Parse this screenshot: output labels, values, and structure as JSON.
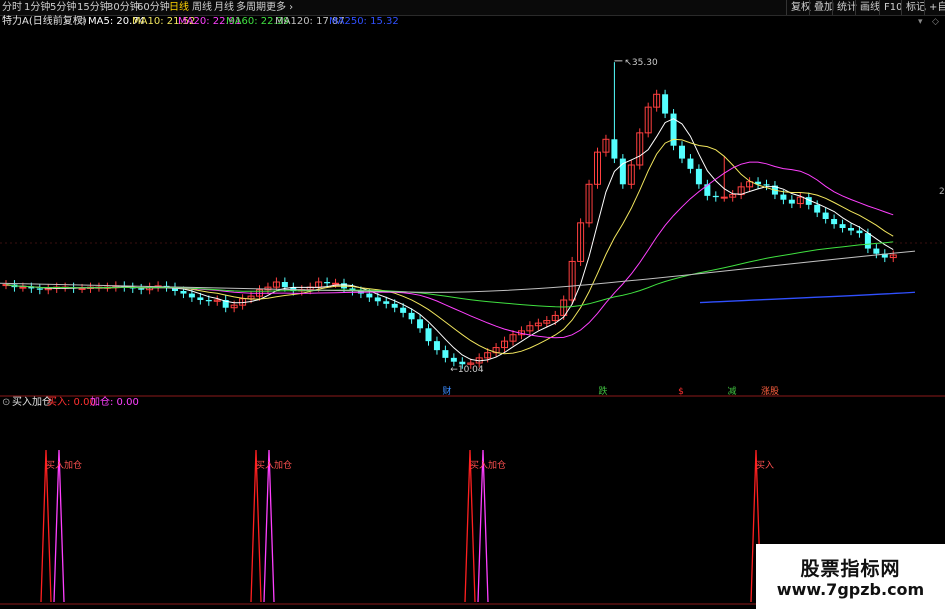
{
  "toolbar": {
    "periods": [
      "分时",
      "1分钟",
      "5分钟",
      "15分钟",
      "30分钟",
      "60分钟",
      "日线",
      "周线",
      "月线",
      "多周期",
      "更多"
    ],
    "active_period": "日线",
    "right_buttons": [
      "复权",
      "叠加",
      "统计",
      "画线",
      "F10",
      "标记",
      "+自"
    ]
  },
  "ma_header": {
    "stock_name": "特力A(日线前复权)",
    "items": [
      {
        "label": "MA5: 20.74",
        "color": "#ffffff"
      },
      {
        "label": "MA10: 21.52",
        "color": "#f2e65e"
      },
      {
        "label": "MA20: 22.91",
        "color": "#ff40ff"
      },
      {
        "label": "MA60: 22.39",
        "color": "#40e040"
      },
      {
        "label": "MA120: 17.87",
        "color": "#c0c0c0"
      },
      {
        "label": "MA250: 15.32",
        "color": "#3050ff"
      }
    ]
  },
  "price_annotations": {
    "high": "35.30",
    "low": "10.04"
  },
  "event_markers": [
    {
      "text": "财",
      "color": "#3a8bff"
    },
    {
      "text": "跌",
      "color": "#40c040"
    },
    {
      "text": "$",
      "color": "#ff3030"
    },
    {
      "text": "减",
      "color": "#40c040"
    },
    {
      "text": "涨股",
      "color": "#ff6040"
    }
  ],
  "indicator": {
    "name": "买入加仓",
    "buy_label": "买入: 0.00",
    "add_label": "加仓: 0.00",
    "signals": [
      {
        "label": "买入加仓"
      },
      {
        "label": "买入加仓"
      },
      {
        "label": "买入加仓"
      },
      {
        "label": "买入"
      }
    ]
  },
  "right_axis_label": "2",
  "watermark": {
    "line1": "股票指标网",
    "line2": "www.7gpzb.com"
  },
  "chart_data": {
    "type": "candlestick",
    "closes": [
      17.2,
      17.0,
      17.0,
      16.9,
      16.8,
      16.9,
      17.0,
      17.0,
      16.9,
      16.9,
      17.0,
      17.0,
      17.0,
      17.1,
      17.0,
      16.9,
      16.8,
      17.0,
      17.1,
      17.0,
      16.7,
      16.5,
      16.2,
      16.0,
      15.9,
      16.0,
      15.4,
      15.6,
      16.1,
      16.3,
      16.8,
      17.0,
      17.4,
      17.0,
      16.7,
      16.8,
      17.0,
      17.4,
      17.3,
      17.3,
      16.9,
      16.7,
      16.5,
      16.2,
      15.9,
      15.7,
      15.4,
      15.0,
      14.5,
      13.8,
      12.8,
      12.1,
      11.5,
      11.2,
      11.0,
      11.1,
      11.5,
      11.9,
      12.3,
      12.8,
      13.3,
      13.6,
      14.0,
      14.2,
      14.4,
      14.8,
      16.0,
      19.0,
      22.0,
      25.0,
      27.5,
      28.5,
      27.0,
      25.0,
      26.5,
      29.0,
      31.0,
      32.0,
      30.5,
      28.0,
      27.0,
      26.2,
      25.0,
      24.1,
      24.0,
      24.0,
      24.2,
      24.8,
      25.2,
      25.0,
      24.9,
      24.2,
      23.8,
      23.5,
      24.0,
      23.4,
      22.8,
      22.3,
      21.9,
      21.6,
      21.4,
      21.2,
      20.0,
      19.6,
      19.3,
      19.5
    ]
  }
}
